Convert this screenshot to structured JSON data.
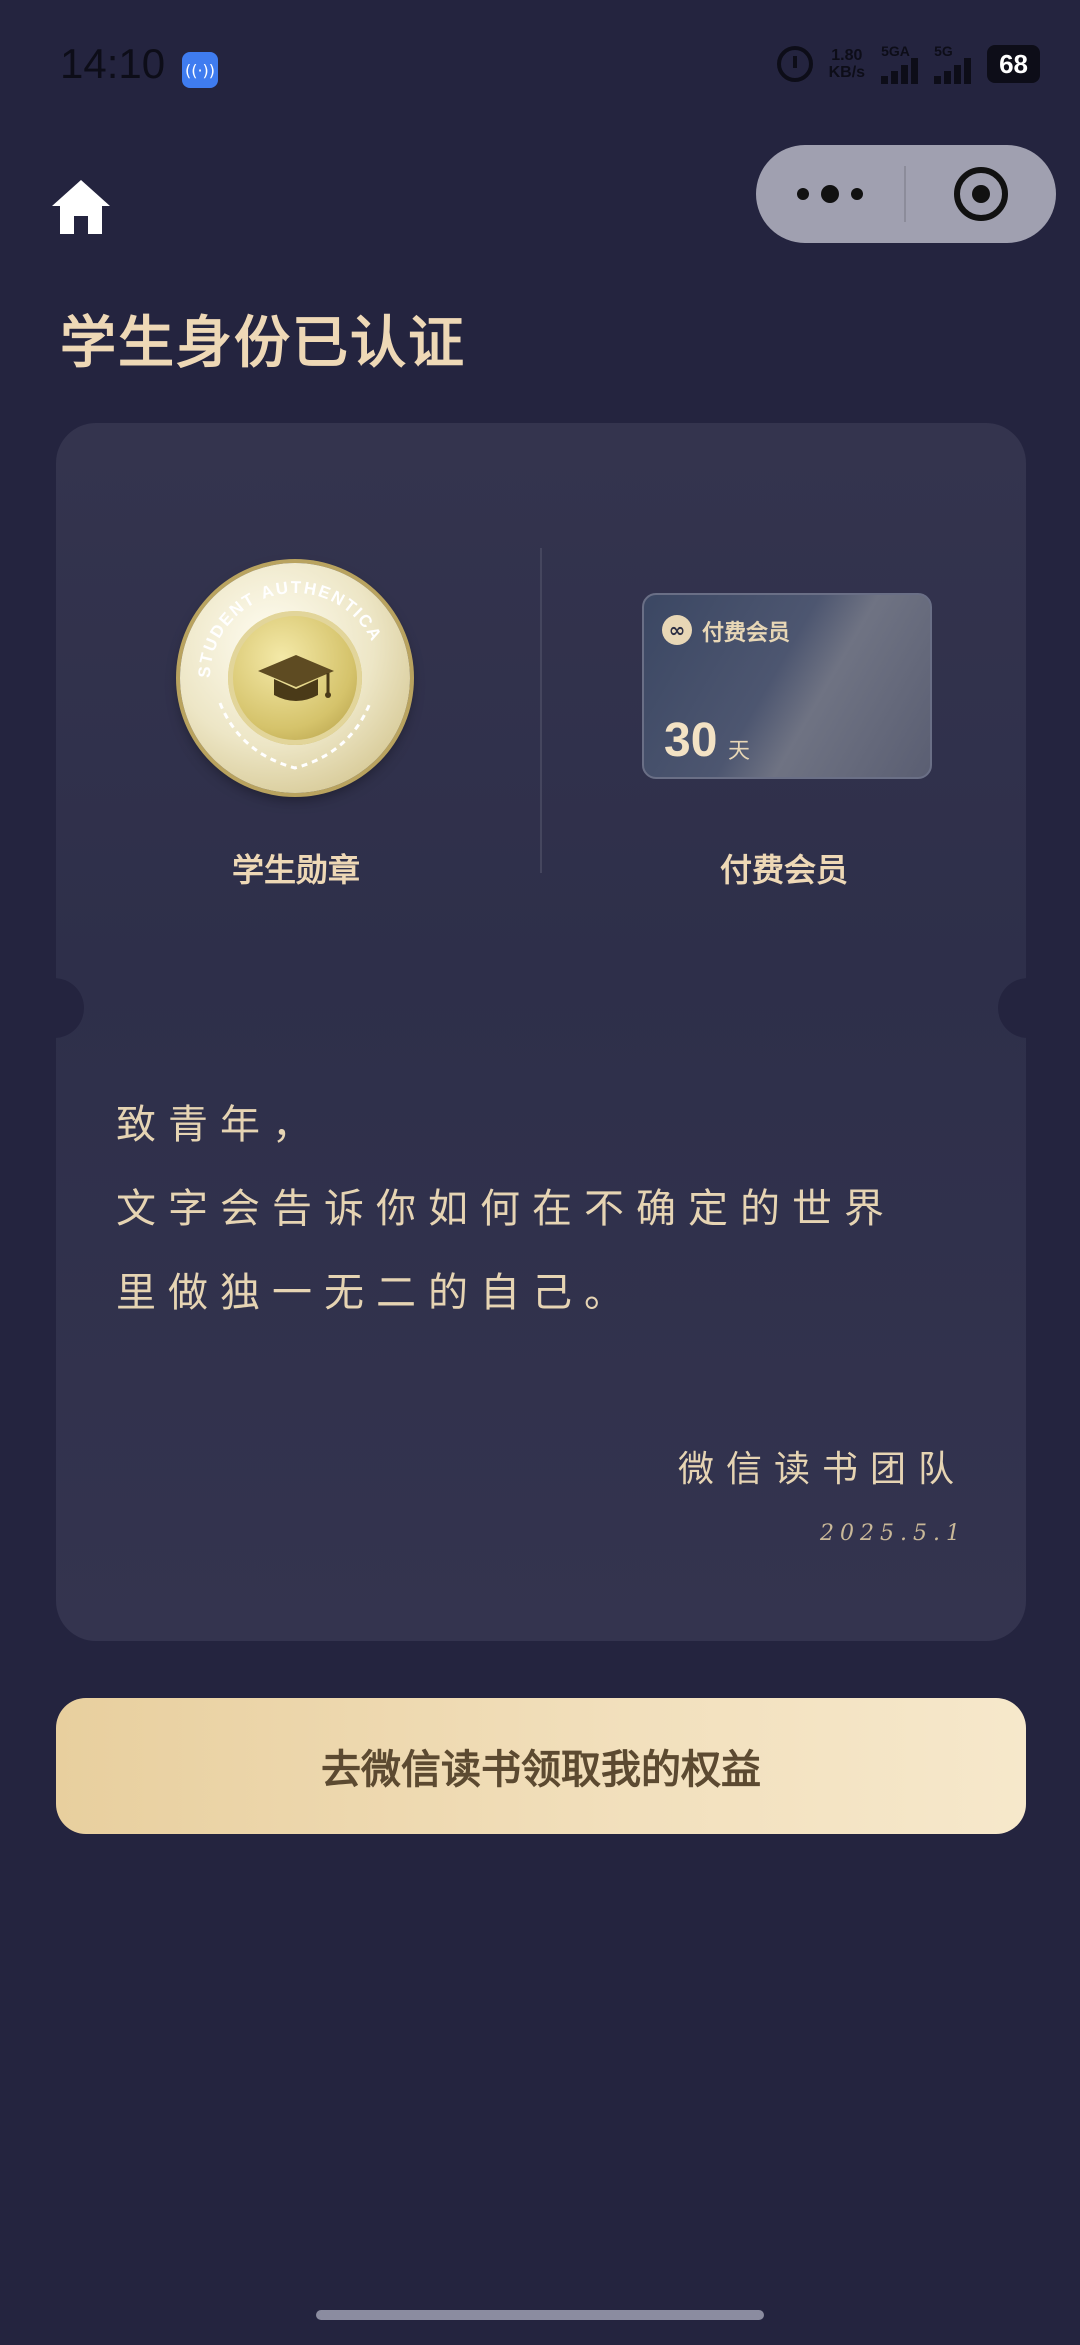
{
  "status": {
    "time": "14:10",
    "speed_top": "1.80",
    "speed_bottom": "KB/s",
    "sig1": "5GA",
    "sig2": "5G",
    "battery": "68",
    "app_icon": "hotspot-icon"
  },
  "page": {
    "title": "学生身份已认证",
    "home_icon": "home-icon",
    "capsule_more_icon": "more-dots-icon",
    "capsule_close_icon": "target-icon"
  },
  "rewards": {
    "badge_label": "学生勋章",
    "badge_ring_text": "STUDENT AUTHENTICA",
    "vip_label": "付费会员",
    "vip_card_title": "付费会员",
    "vip_days": "30",
    "vip_unit": "天"
  },
  "letter": {
    "line1": "致青年，",
    "line2": "文字会告诉你如何在不确定的世界",
    "line3": "里做独一无二的自己。",
    "signature": "微信读书团队",
    "date": "2025.5.1"
  },
  "cta": {
    "label": "去微信读书领取我的权益"
  }
}
